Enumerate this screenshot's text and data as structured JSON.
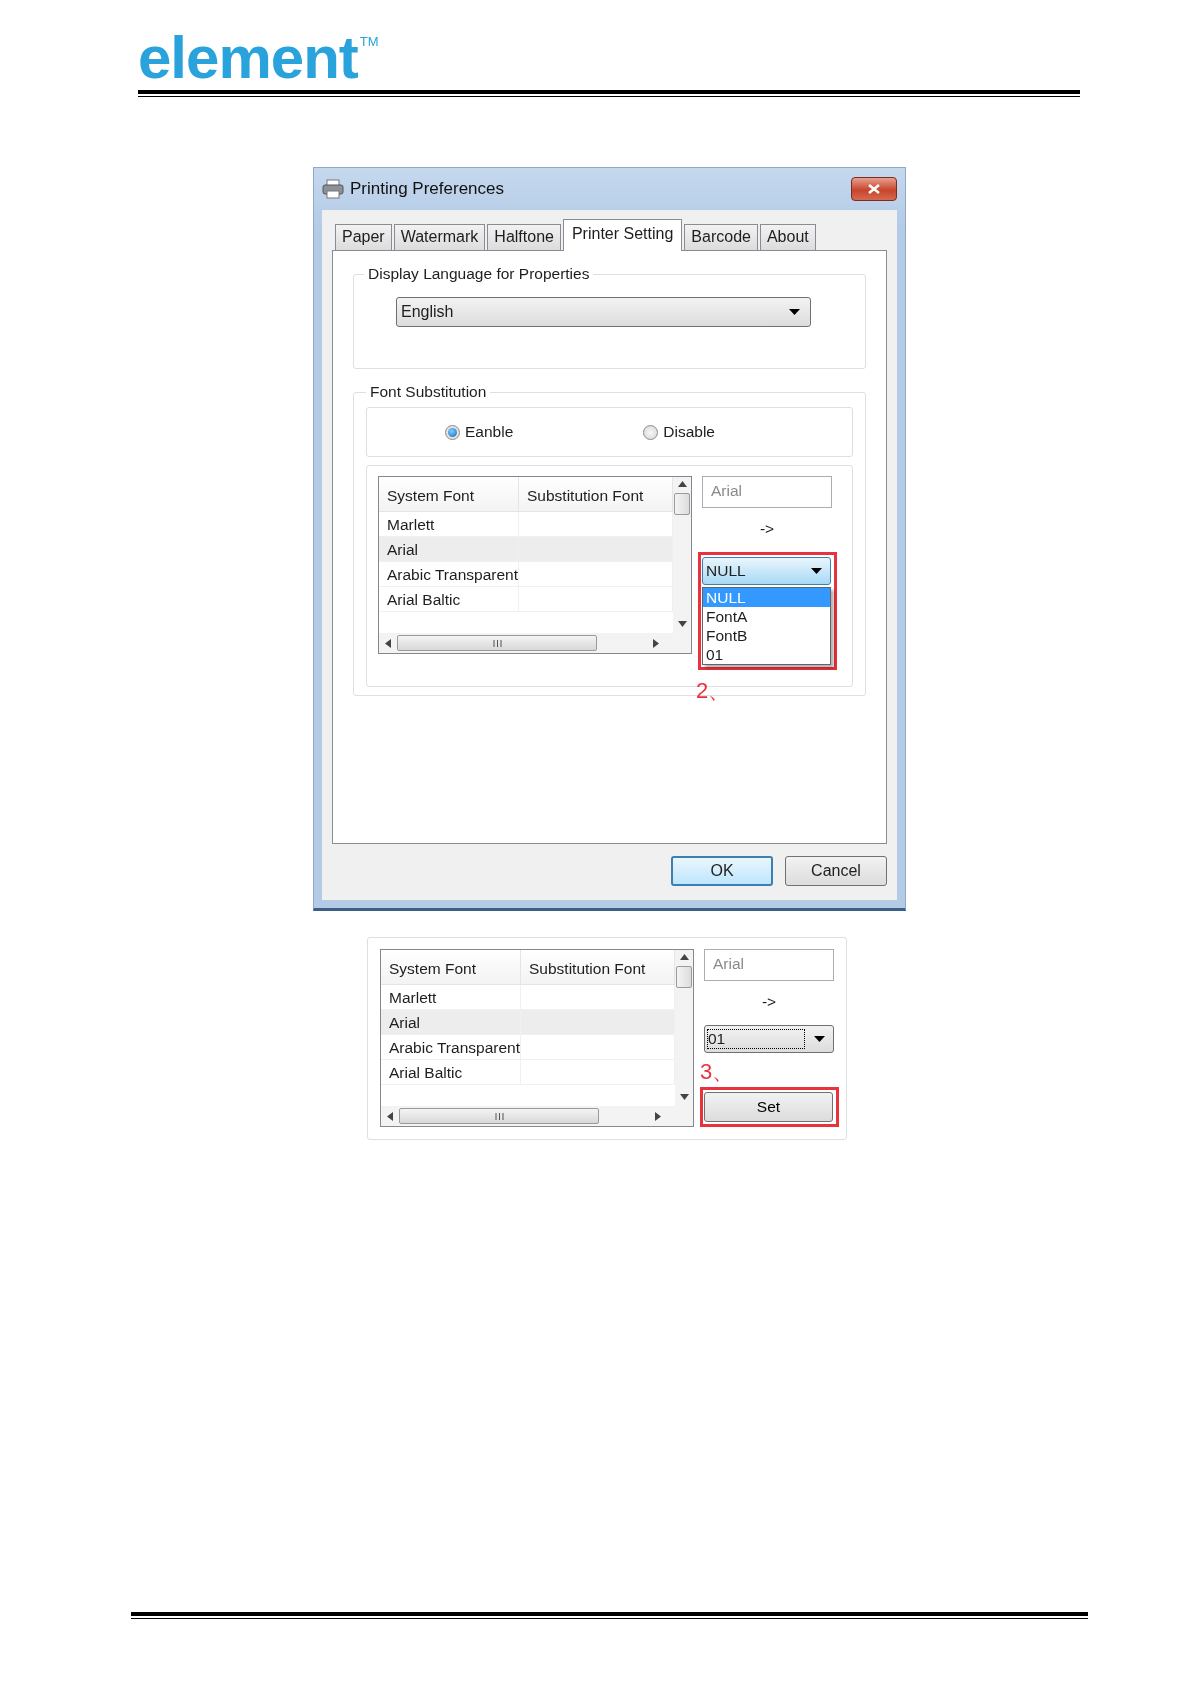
{
  "header": {
    "logo": "element",
    "trademark": "TM"
  },
  "dialog": {
    "title": "Printing Preferences",
    "tabs": [
      {
        "label": "Paper",
        "selected": false
      },
      {
        "label": "Watermark",
        "selected": false
      },
      {
        "label": "Halftone",
        "selected": false
      },
      {
        "label": "Printer Setting",
        "selected": true
      },
      {
        "label": "Barcode",
        "selected": false
      },
      {
        "label": "About",
        "selected": false
      }
    ],
    "language_group": {
      "legend": "Display Language for Properties",
      "value": "English"
    },
    "font_substitution": {
      "legend": "Font Substitution",
      "options": [
        {
          "label": "Eanble",
          "selected": true
        },
        {
          "label": "Disable",
          "selected": false
        }
      ],
      "editor": {
        "columns": [
          "System Font",
          "Substitution Font"
        ],
        "rows": [
          {
            "system_font": "Marlett",
            "selected": false
          },
          {
            "system_font": "Arial",
            "selected": true
          },
          {
            "system_font": "Arabic Transparent",
            "selected": false
          },
          {
            "system_font": "Arial Baltic",
            "selected": false
          }
        ],
        "source_font": "Arial",
        "arrow": "->",
        "target": {
          "value": "NULL",
          "open": true,
          "focused": false,
          "highlighted": true
        },
        "dropdown": [
          {
            "label": "NULL",
            "selected": true
          },
          {
            "label": "FontA",
            "selected": false
          },
          {
            "label": "FontB",
            "selected": false
          },
          {
            "label": "01",
            "selected": false
          }
        ],
        "step": "2、"
      }
    },
    "buttons": [
      {
        "label": "OK",
        "default": true
      },
      {
        "label": "Cancel",
        "default": false
      }
    ]
  },
  "detail_panel": {
    "columns": [
      "System Font",
      "Substitution Font"
    ],
    "rows": [
      {
        "system_font": "Marlett",
        "selected": false
      },
      {
        "system_font": "Arial",
        "selected": true
      },
      {
        "system_font": "Arabic Transparent",
        "selected": false
      },
      {
        "system_font": "Arial Baltic",
        "selected": false
      }
    ],
    "source_font": "Arial",
    "arrow": "->",
    "target": {
      "value": "01",
      "open": false,
      "focused": true,
      "highlighted": false
    },
    "step": "3、",
    "set_button": {
      "label": "Set",
      "highlighted": true
    }
  }
}
